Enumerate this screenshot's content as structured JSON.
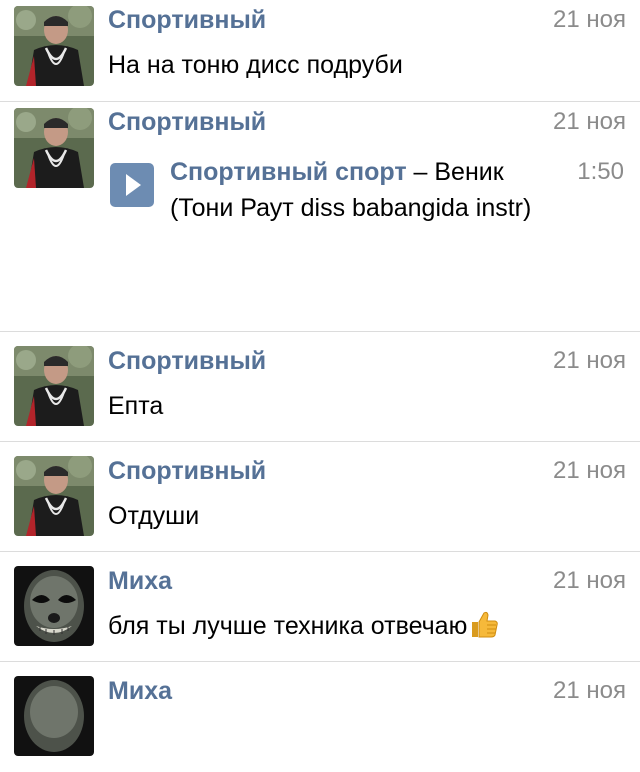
{
  "messages": [
    {
      "author": "Спортивный",
      "date": "21 ноя",
      "text": "На на тоню дисс подруби"
    },
    {
      "author": "Спортивный",
      "date": "21 ноя",
      "audio": {
        "artist": "Спортивный спорт",
        "separator": " – ",
        "title": "Веник (Тони Раут diss babangida instr)",
        "duration": "1:50"
      }
    },
    {
      "author": "Спортивный",
      "date": "21 ноя",
      "text": "Епта"
    },
    {
      "author": "Спортивный",
      "date": "21 ноя",
      "text": "Отдуши"
    },
    {
      "author": "Миха",
      "date": "21 ноя",
      "text": "бля ты лучше техника отвечаю"
    },
    {
      "author": "Миха",
      "date": "21 ноя"
    }
  ],
  "icons": {
    "play": "play-icon",
    "thumbs_up": "thumbs-up-emoji"
  },
  "colors": {
    "author_name": "#557196",
    "play_button": "#6d8cb2",
    "date": "#8b8b8b"
  }
}
